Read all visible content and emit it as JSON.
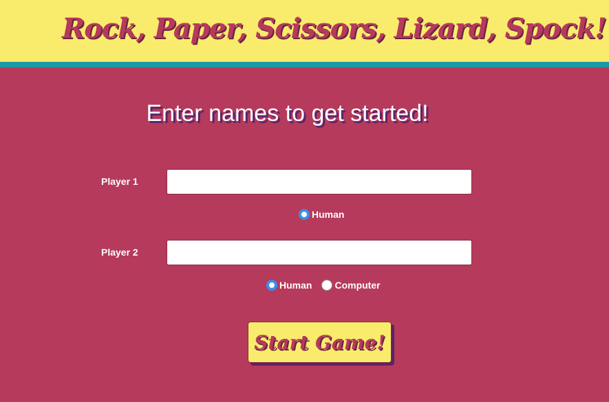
{
  "header": {
    "title": "Rock, Paper, Scissors, Lizard, Spock!"
  },
  "main": {
    "heading": "Enter names to get started!",
    "player1": {
      "label": "Player 1",
      "value": "",
      "options": [
        {
          "label": "Human",
          "checked": true
        }
      ]
    },
    "player2": {
      "label": "Player 2",
      "value": "",
      "options": [
        {
          "label": "Human",
          "checked": true
        },
        {
          "label": "Computer",
          "checked": false
        }
      ]
    },
    "start_button": "Start Game!"
  },
  "colors": {
    "background": "#b63a5b",
    "header": "#f9ec6c",
    "stripe": "#1a9aa6",
    "radio_selected": "#3a8ee8"
  }
}
